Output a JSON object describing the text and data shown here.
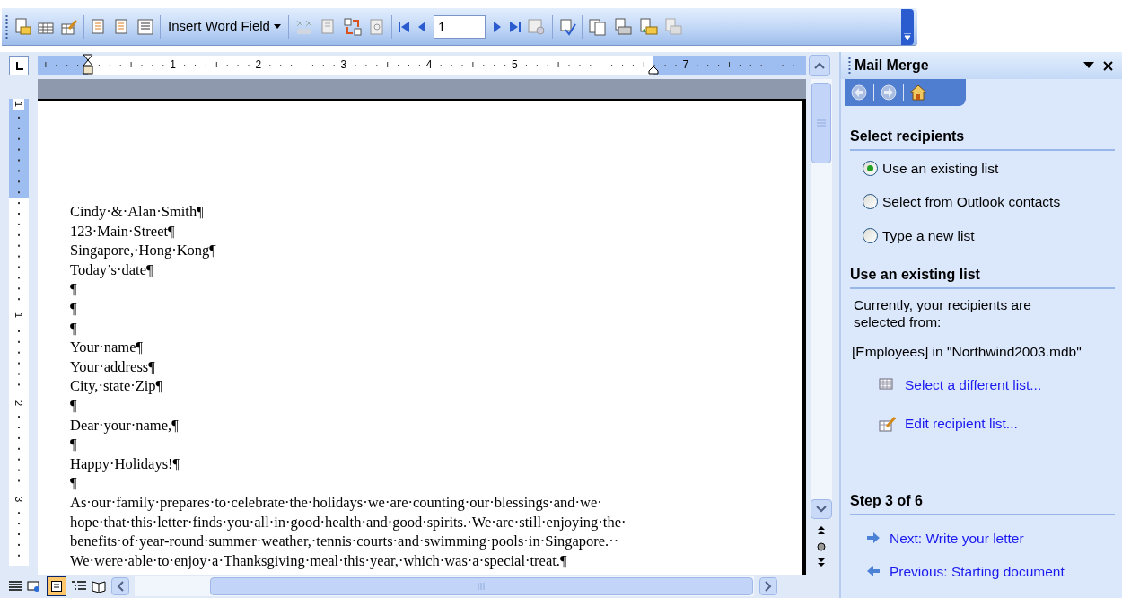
{
  "toolbar": {
    "insert_field_button": "Insert Word Field",
    "record_field": "1"
  },
  "ruler": {
    "numbers": [
      "1",
      "2",
      "3",
      "4",
      "5",
      "7"
    ]
  },
  "vertical_ruler": {
    "numbers": [
      "1",
      "1",
      "2",
      "3"
    ]
  },
  "document": {
    "lines": [
      "Cindy·&·Alan·Smith¶",
      "123·Main·Street¶",
      "Singapore,·Hong·Kong¶",
      "Today’s·date¶",
      "¶",
      "¶",
      "¶",
      "Your·name¶",
      "Your·address¶",
      "City,·state·Zip¶",
      "¶",
      "Dear·your·name,¶",
      "¶",
      "Happy·Holidays!¶",
      "¶",
      "As·our·family·prepares·to·celebrate·the·holidays·we·are·counting·our·blessings·and·we·",
      "hope·that·this·letter·finds·you·all·in·good·health·and·good·spirits.·We·are·still·enjoying·the·",
      "benefits·of·year-round·summer·weather,·tennis·courts·and·swimming·pools·in·Singapore.··",
      "We·were·able·to·enjoy·a·Thanksgiving·meal·this·year,·which·was·a·special·treat.¶"
    ]
  },
  "task_pane": {
    "title": "Mail Merge",
    "sections": [
      {
        "heading": "Select recipients",
        "options": [
          {
            "label": "Use an existing list",
            "selected": true
          },
          {
            "label": "Select from Outlook contacts",
            "selected": false
          },
          {
            "label": "Type a new list",
            "selected": false
          }
        ]
      },
      {
        "heading": "Use an existing list",
        "description": "Currently, your recipients are selected from:",
        "source": "[Employees] in \"Northwind2003.mdb\"",
        "links": [
          {
            "label": "Select a different list...",
            "kind": "grid"
          },
          {
            "label": "Edit recipient list...",
            "kind": "edit"
          }
        ]
      }
    ],
    "step": {
      "heading": "Step 3 of 6",
      "links": [
        {
          "label": "Next: Write your letter",
          "kind": "next"
        },
        {
          "label": "Previous: Starting document",
          "kind": "previous"
        }
      ]
    }
  }
}
